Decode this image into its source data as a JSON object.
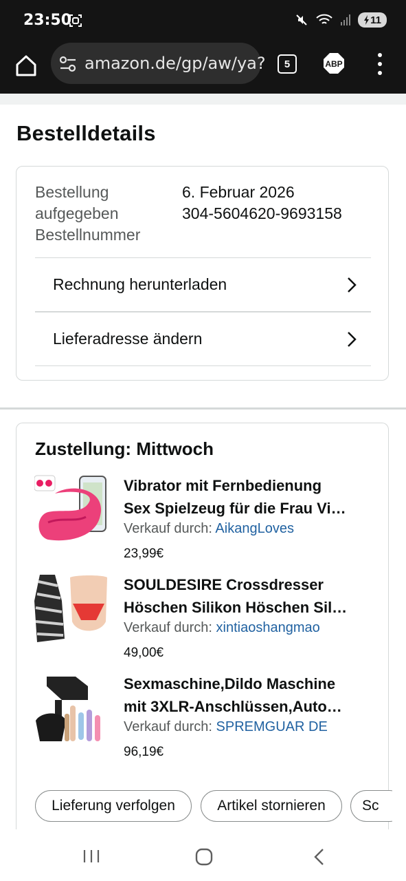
{
  "status_bar": {
    "time": "23:50",
    "battery": "11",
    "icons": [
      "screenshot-icon",
      "mute-icon",
      "wifi-icon",
      "signal-icon",
      "battery-charging-icon"
    ]
  },
  "browser": {
    "url": "amazon.de/gp/aw/ya?",
    "tab_count": "5",
    "adblock_label": "ABP"
  },
  "page": {
    "title": "Bestelldetails",
    "order": {
      "labels": [
        "Bestellung",
        "aufgegeben",
        "Bestellnummer"
      ],
      "date": "6. Februar 2026",
      "number": "304-5604620-9693158"
    },
    "links": [
      {
        "label": "Rechnung herunterladen"
      },
      {
        "label": "Lieferadresse ändern"
      }
    ],
    "delivery": {
      "title": "Zustellung: Mittwoch",
      "seller_prefix": "Verkauf durch: ",
      "items": [
        {
          "name_line1": "Vibrator mit Fernbedienung",
          "name_line2": "Sex Spielzeug für die Frau Vi…",
          "seller": "AikangLoves",
          "price": "23,99€"
        },
        {
          "name_line1": "SOULDESIRE Crossdresser",
          "name_line2": "Höschen Silikon Höschen Sil…",
          "seller": "xintiaoshangmao",
          "price": "49,00€"
        },
        {
          "name_line1": "Sexmaschine,Dildo Maschine",
          "name_line2": "mit 3XLR-Anschlüssen,Auto…",
          "seller": "SPREMGUAR DE",
          "price": "96,19€"
        }
      ]
    },
    "actions": [
      "Lieferung verfolgen",
      "Artikel stornieren",
      "Sc"
    ]
  },
  "colors": {
    "link_blue": "#2162a1",
    "muted_text": "#565959",
    "border": "#d5d9d9",
    "dark_chrome": "#141414"
  }
}
